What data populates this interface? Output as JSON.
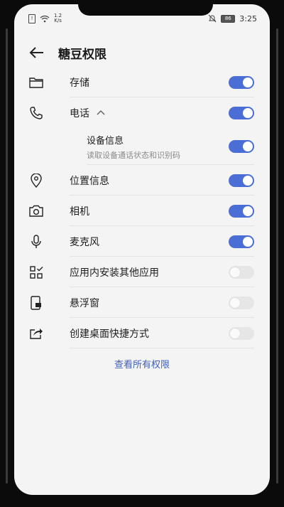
{
  "status_bar": {
    "speed_value": "1.2",
    "speed_unit": "K/s",
    "battery": "86",
    "time": "3:25"
  },
  "header": {
    "title": "糖豆权限"
  },
  "permissions": [
    {
      "label": "存储",
      "icon": "folder-icon",
      "enabled": true
    },
    {
      "label": "电话",
      "icon": "phone-icon",
      "enabled": true,
      "expanded": true
    },
    {
      "label": "设备信息",
      "desc": "读取设备通话状态和识别码",
      "enabled": true,
      "sub": true
    },
    {
      "label": "位置信息",
      "icon": "location-icon",
      "enabled": true
    },
    {
      "label": "相机",
      "icon": "camera-icon",
      "enabled": true
    },
    {
      "label": "麦克风",
      "icon": "microphone-icon",
      "enabled": true
    },
    {
      "label": "应用内安装其他应用",
      "icon": "app-grid-icon",
      "enabled": false
    },
    {
      "label": "悬浮窗",
      "icon": "floating-window-icon",
      "enabled": false
    },
    {
      "label": "创建桌面快捷方式",
      "icon": "share-shortcut-icon",
      "enabled": false
    }
  ],
  "footer": {
    "view_all": "查看所有权限"
  },
  "colors": {
    "toggle_on": "#4b6ed6",
    "link": "#3f5fb5"
  }
}
